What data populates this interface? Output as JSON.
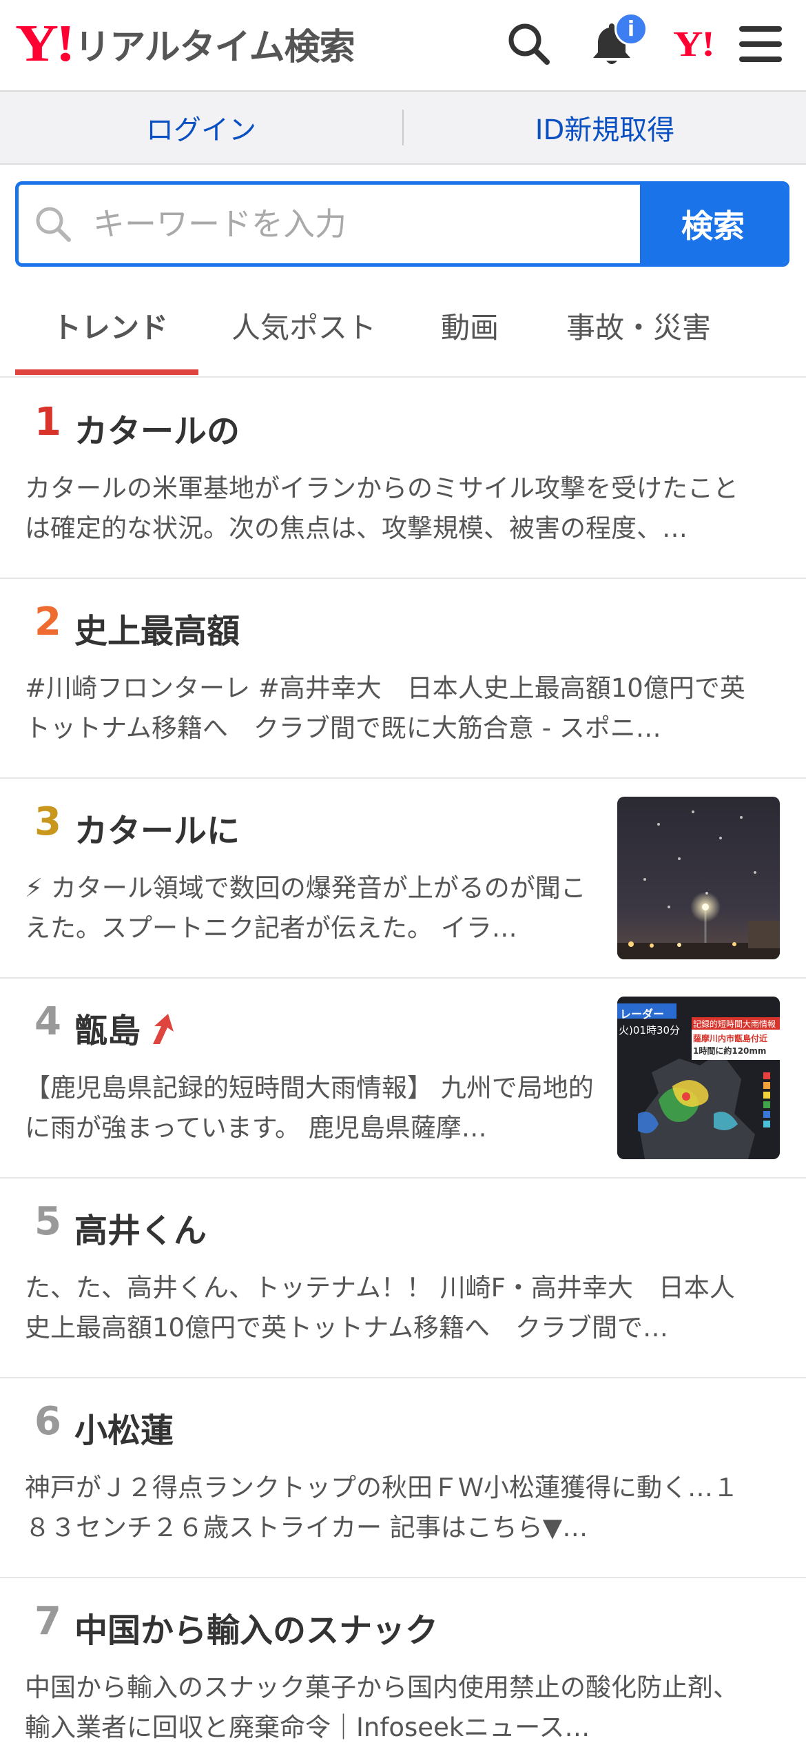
{
  "header": {
    "logo_mark": "Y!",
    "logo_text": "リアルタイム検索",
    "notification_badge": "i",
    "yjapan_mark": "Y!"
  },
  "account": {
    "login_label": "ログイン",
    "register_label": "ID新規取得"
  },
  "search": {
    "placeholder": "キーワードを入力",
    "value": "",
    "button_label": "検索"
  },
  "tabs": [
    {
      "label": "トレンド",
      "active": true
    },
    {
      "label": "人気ポスト",
      "active": false
    },
    {
      "label": "動画",
      "active": false
    },
    {
      "label": "事故・災害",
      "active": false
    }
  ],
  "colors": {
    "accent_blue": "#1a73e8",
    "brand_red": "#ff0033",
    "tab_indicator": "#e0443e",
    "rank_1": "#d9342b",
    "rank_2": "#ef6c31",
    "rank_3": "#c9971c",
    "rank_other": "#999999"
  },
  "trends": [
    {
      "rank": "1",
      "title": "カタールの",
      "description": "カタールの米軍基地がイランからのミサイル攻撃を受けたことは確定的な状況。次の焦点は、攻撃規模、被害の程度、…",
      "has_thumbnail": false,
      "rising": false
    },
    {
      "rank": "2",
      "title": "史上最高額",
      "description": "#川崎フロンターレ #高井幸大　日本人史上最高額10億円で英トットナム移籍へ　クラブ間で既に大筋合意 - スポニ…",
      "has_thumbnail": false,
      "rising": false
    },
    {
      "rank": "3",
      "title": "カタールに",
      "description": "⚡ カタール領域で数回の爆発音が上がるのが聞こえた。スプートニク記者が伝えた。 イラ…",
      "has_thumbnail": true,
      "rising": false
    },
    {
      "rank": "4",
      "title": "甑島",
      "description": "【鹿児島県記録的短時間大雨情報】 九州で局地的に雨が強まっています。 鹿児島県薩摩…",
      "has_thumbnail": true,
      "rising": true,
      "thumbnail_text": {
        "label": "レーダー",
        "time": "火)01時30分",
        "alert_title": "記録的短時間大雨情報",
        "alert_line1": "薩摩川内市甑島付近",
        "alert_line2": "1時間に約120mm"
      }
    },
    {
      "rank": "5",
      "title": "高井くん",
      "description": "た、た、高井くん、トッテナム！！ 川崎F・高井幸大　日本人史上最高額10億円で英トットナム移籍へ　クラブ間で…",
      "has_thumbnail": false,
      "rising": false
    },
    {
      "rank": "6",
      "title": "小松蓮",
      "description": "神戸がＪ２得点ランクトップの秋田ＦＷ小松蓮獲得に動く…１８３センチ２６歳ストライカー 記事はこちら▼…",
      "has_thumbnail": false,
      "rising": false
    },
    {
      "rank": "7",
      "title": "中国から輸入のスナック",
      "description": "中国から輸入のスナック菓子から国内使用禁止の酸化防止剤、輸入業者に回収と廃棄命令｜Infoseekニュース…",
      "has_thumbnail": false,
      "rising": false
    }
  ]
}
